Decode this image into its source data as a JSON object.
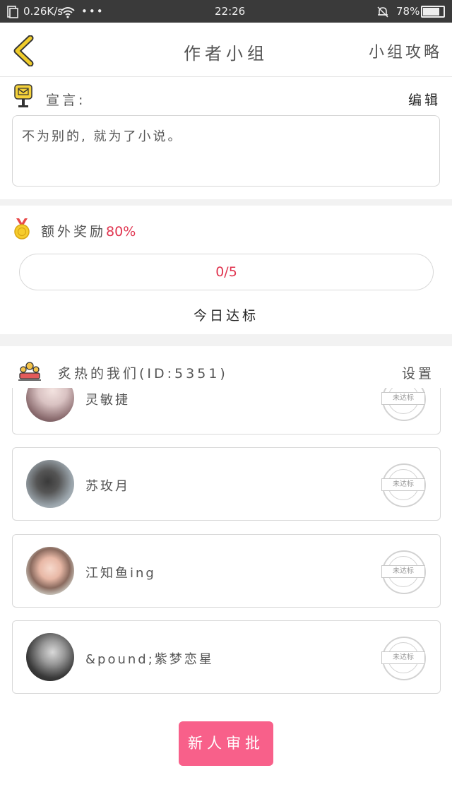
{
  "status_bar": {
    "network_speed": "0.26K/s",
    "time": "22:26",
    "battery": "78%",
    "battery_level": 0.78,
    "icons": [
      "screen-icon",
      "wifi-icon",
      "more-dots-icon",
      "bell-off-icon",
      "battery-icon"
    ]
  },
  "header": {
    "back_icon": "chevron-left-icon",
    "title": "作者小组",
    "guide": "小组攻略"
  },
  "declaration": {
    "icon": "mailbox-icon",
    "label": "宣言:",
    "edit": "编辑",
    "text": "不为别的, 就为了小说。"
  },
  "reward": {
    "icon": "medal-icon",
    "label": "额外奖励",
    "percent": "80%",
    "progress_text": "0/5",
    "progress_value": 0,
    "target": "今日达标"
  },
  "group": {
    "icon": "group-icon",
    "name": "炙热的我们(ID:5351)",
    "settings": "设置"
  },
  "members": [
    {
      "name": "灵敏捷",
      "status": "未达标"
    },
    {
      "name": "苏玫月",
      "status": "未达标"
    },
    {
      "name": "江知鱼ing",
      "status": "未达标"
    },
    {
      "name": "&pound;紫梦恋星",
      "status": "未达标"
    }
  ],
  "approve_button": "新人审批",
  "colors": {
    "accent_pink": "#f8608a",
    "percent_red": "#e0344f",
    "status_bar": "#3a3a3a",
    "back_arrow_fill": "#f0cc2a"
  }
}
